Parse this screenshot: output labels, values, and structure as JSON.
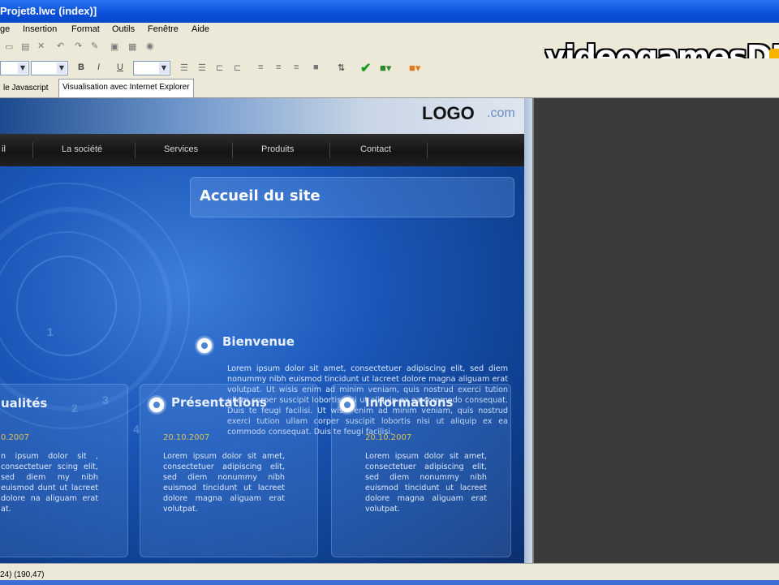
{
  "window": {
    "title": "Projet8.lwc (index)]"
  },
  "menu": [
    "ge",
    "Insertion",
    "Format",
    "Outils",
    "Fenêtre",
    "Aide"
  ],
  "tabs": [
    "le Javascript",
    "Visualisation avec Internet Explorer"
  ],
  "watermark": "videogamesDB",
  "site": {
    "logo": "LOGO",
    "logo_suffix": ".com",
    "nav": [
      "il",
      "La société",
      "Services",
      "Produits",
      "Contact"
    ],
    "page_title": "Accueil du site",
    "welcome": {
      "heading": "Bienvenue",
      "text": "Lorem ipsum dolor sit amet, consectetuer adipiscing elit, sed diem nonummy nibh euismod tincidunt ut lacreet dolore magna aliguam erat volutpat. Ut wisis enim ad minim veniam, quis nostrud exerci tution ullam corper suscipit lobortis nisi ut aliquip ex ea commodo consequat. Duis te feugi facilisi. Ut wisis enim ad minim veniam, quis nostrud exerci tution ullam corper suscipit lobortis nisi ut aliquip ex ea commodo consequat. Duis te feugi facilisi."
    },
    "boxes": [
      {
        "heading": "ualités",
        "date": "0.2007",
        "text": "n ipsum dolor sit , consectetuer scing elit, sed diem my nibh euismod dunt ut lacreet dolore na aliguam erat at."
      },
      {
        "heading": "Présentations",
        "date": "20.10.2007",
        "text": "Lorem ipsum dolor sit amet, consectetuer adipiscing elit, sed diem nonummy nibh euismod tincidunt ut lacreet dolore magna aliguam erat volutpat."
      },
      {
        "heading": "Informations",
        "date": "20.10.2007",
        "text": "Lorem ipsum dolor sit amet, consectetuer adipiscing elit, sed diem nonummy nibh euismod tincidunt ut lacreet dolore magna aliguam erat volutpat."
      }
    ]
  },
  "status": "24)  (190,47)",
  "colors": {
    "titlebar": "#0a4fd8",
    "accent_date": "#d8c24f",
    "content_blue": "#1a57b8",
    "dark_panel": "#3b3b3b"
  }
}
